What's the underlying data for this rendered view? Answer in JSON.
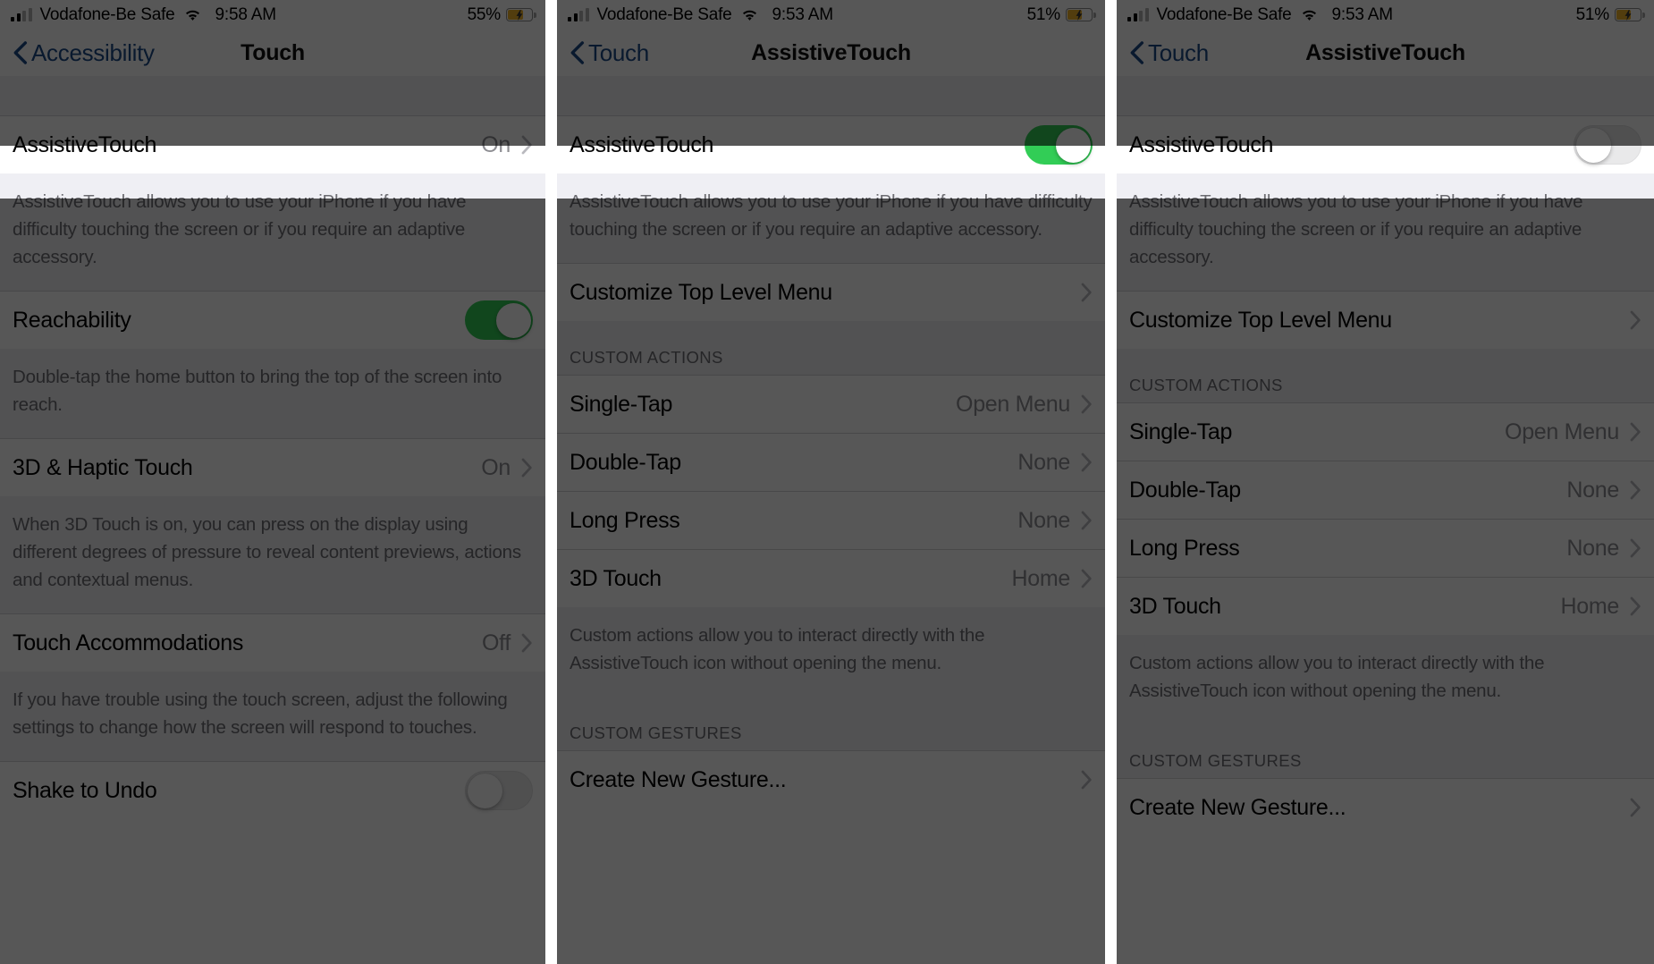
{
  "status_bar": {
    "carrier": "Vodafone-Be Safe",
    "signal_icon": "cellular-signal-icon",
    "wifi_icon": "wifi-icon",
    "battery_icon": "battery-charging-icon",
    "panel1": {
      "time": "9:58 AM",
      "battery_percent": "55%"
    },
    "panel2": {
      "time": "9:53 AM",
      "battery_percent": "51%"
    },
    "panel3": {
      "time": "9:53 AM",
      "battery_percent": "51%"
    }
  },
  "colors": {
    "accent_blue": "#1b4a88",
    "toggle_on_green": "#32cd56",
    "toggle_off_gray": "#e9e9ea",
    "battery_yellow": "#f0b429",
    "secondary_text": "#8e8e93",
    "group_bg": "#efeff4",
    "dim_overlay": "rgba(0,0,0,0.66)"
  },
  "panel1": {
    "nav": {
      "back_label": "Accessibility",
      "back_icon": "chevron-left-icon",
      "title": "Touch"
    },
    "rows": [
      {
        "label": "AssistiveTouch",
        "value": "On",
        "accessory": "chevron-right-icon"
      },
      {
        "label": "Reachability",
        "accessory": "toggle",
        "toggle": "on"
      },
      {
        "label": "3D & Haptic Touch",
        "value": "On",
        "accessory": "chevron-right-icon"
      },
      {
        "label": "Touch Accommodations",
        "value": "Off",
        "accessory": "chevron-right-icon"
      },
      {
        "label": "Shake to Undo",
        "accessory": "toggle",
        "toggle": "off"
      }
    ],
    "footers": {
      "assistivetouch": "AssistiveTouch allows you to use your iPhone if you have difficulty touching the screen or if you require an adaptive accessory.",
      "reachability": "Double-tap the home button to bring the top of the screen into reach.",
      "haptic": "When 3D Touch is on, you can press on the display using different degrees of pressure to reveal content previews, actions and contextual menus.",
      "accommodations": "If you have trouble using the touch screen, adjust the following settings to change how the screen will respond to touches."
    }
  },
  "panel2": {
    "nav": {
      "back_label": "Touch",
      "back_icon": "chevron-left-icon",
      "title": "AssistiveTouch"
    },
    "toggle_row": {
      "label": "AssistiveTouch",
      "toggle": "on"
    },
    "footer_main": "AssistiveTouch allows you to use your iPhone if you have difficulty touching the screen or if you require an adaptive accessory.",
    "customize_row": {
      "label": "Customize Top Level Menu",
      "accessory": "chevron-right-icon"
    },
    "custom_actions_header": "CUSTOM ACTIONS",
    "custom_actions": [
      {
        "label": "Single-Tap",
        "value": "Open Menu",
        "accessory": "chevron-right-icon"
      },
      {
        "label": "Double-Tap",
        "value": "None",
        "accessory": "chevron-right-icon"
      },
      {
        "label": "Long Press",
        "value": "None",
        "accessory": "chevron-right-icon"
      },
      {
        "label": "3D Touch",
        "value": "Home",
        "accessory": "chevron-right-icon"
      }
    ],
    "custom_actions_footer": "Custom actions allow you to interact directly with the AssistiveTouch icon without opening the menu.",
    "custom_gestures_header": "CUSTOM GESTURES",
    "create_gesture_row": {
      "label": "Create New Gesture...",
      "accessory": "chevron-right-icon"
    }
  },
  "panel3": {
    "nav": {
      "back_label": "Touch",
      "back_icon": "chevron-left-icon",
      "title": "AssistiveTouch"
    },
    "toggle_row": {
      "label": "AssistiveTouch",
      "toggle": "off"
    },
    "footer_main": "AssistiveTouch allows you to use your iPhone if you have difficulty touching the screen or if you require an adaptive accessory.",
    "customize_row": {
      "label": "Customize Top Level Menu",
      "accessory": "chevron-right-icon"
    },
    "custom_actions_header": "CUSTOM ACTIONS",
    "custom_actions": [
      {
        "label": "Single-Tap",
        "value": "Open Menu",
        "accessory": "chevron-right-icon"
      },
      {
        "label": "Double-Tap",
        "value": "None",
        "accessory": "chevron-right-icon"
      },
      {
        "label": "Long Press",
        "value": "None",
        "accessory": "chevron-right-icon"
      },
      {
        "label": "3D Touch",
        "value": "Home",
        "accessory": "chevron-right-icon"
      }
    ],
    "custom_actions_footer": "Custom actions allow you to interact directly with the AssistiveTouch icon without opening the menu.",
    "custom_gestures_header": "CUSTOM GESTURES",
    "create_gesture_row": {
      "label": "Create New Gesture...",
      "accessory": "chevron-right-icon"
    }
  }
}
